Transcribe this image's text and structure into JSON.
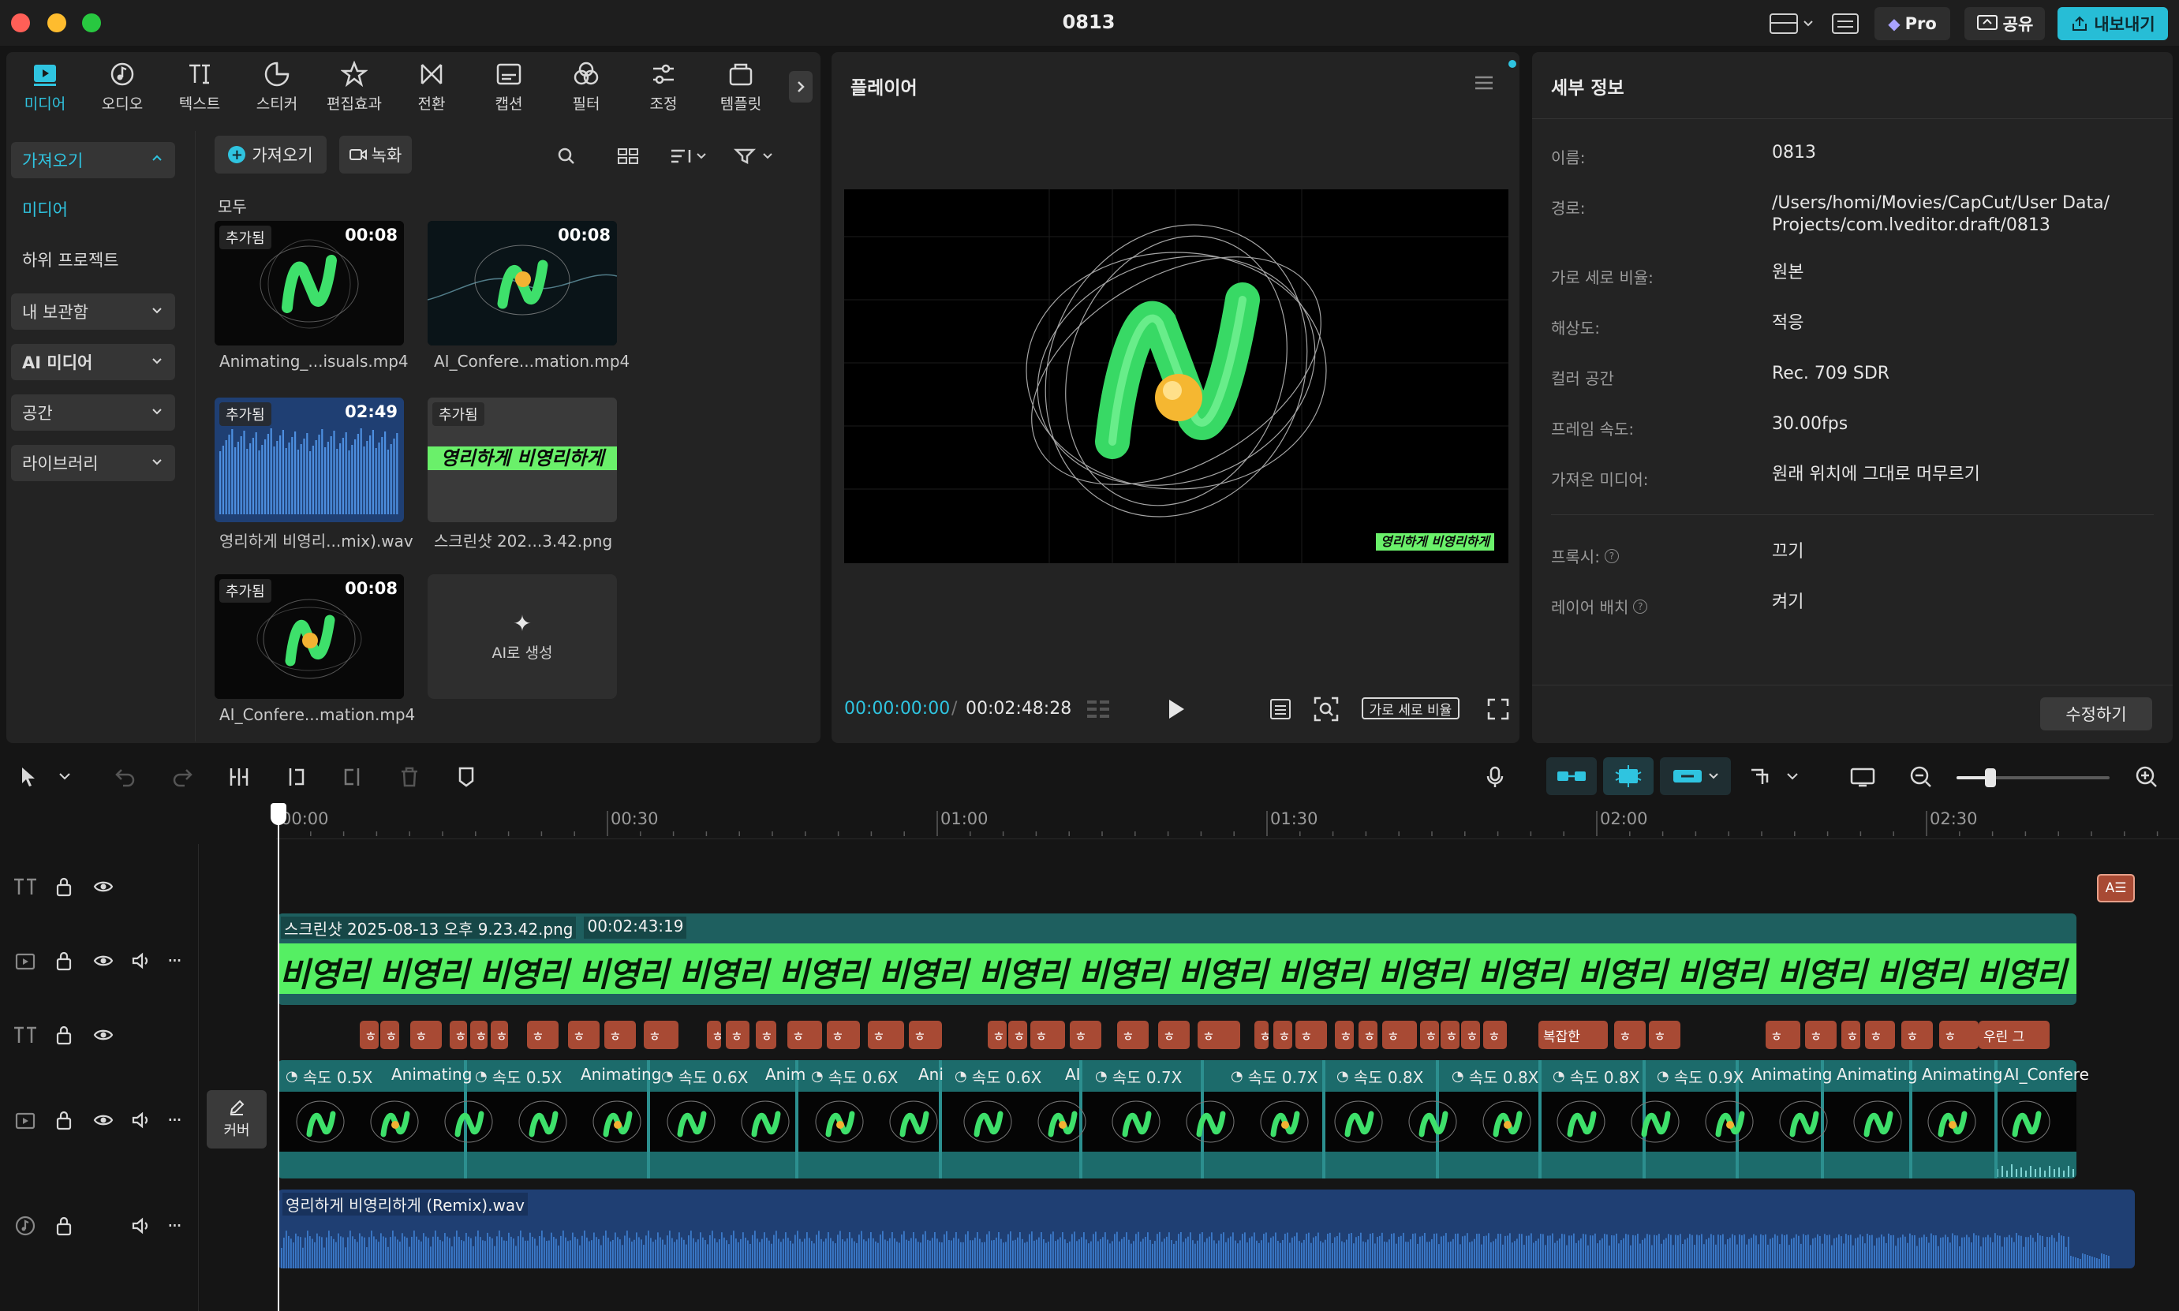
{
  "window": {
    "title": "0813"
  },
  "topbar": {
    "pro_label": "Pro",
    "share_label": "공유",
    "export_label": "내보내기"
  },
  "tool_tabs": [
    {
      "label": "미디어",
      "icon": "media-icon"
    },
    {
      "label": "오디오",
      "icon": "audio-icon"
    },
    {
      "label": "텍스트",
      "icon": "text-icon"
    },
    {
      "label": "스티커",
      "icon": "sticker-icon"
    },
    {
      "label": "편집효과",
      "icon": "effects-icon"
    },
    {
      "label": "전환",
      "icon": "transition-icon"
    },
    {
      "label": "캡션",
      "icon": "caption-icon"
    },
    {
      "label": "필터",
      "icon": "filter-icon"
    },
    {
      "label": "조정",
      "icon": "adjust-icon"
    },
    {
      "label": "템플릿",
      "icon": "template-icon"
    }
  ],
  "side_nav": {
    "import": "가져오기",
    "media": "미디어",
    "subproject": "하위 프로젝트",
    "my_storage": "내 보관함",
    "ai_media": "AI 미디어",
    "space": "공간",
    "library": "라이브러리"
  },
  "media_toolbar": {
    "import_button": "가져오기",
    "record_button": "녹화",
    "all_label": "모두"
  },
  "media_items": [
    {
      "name": "Animating_...isuals.mp4",
      "badge": "추가됨",
      "duration": "00:08"
    },
    {
      "name": "AI_Confere...mation.mp4",
      "badge": "",
      "duration": "00:08"
    },
    {
      "name": "영리하게 비영리...mix).wav",
      "badge": "추가됨",
      "duration": "02:49"
    },
    {
      "name": "스크린샷 202...3.42.png",
      "badge": "추가됨",
      "duration": "",
      "preview_text": "영리하게 비영리하게"
    },
    {
      "name": "AI_Confere...mation.mp4",
      "badge": "추가됨",
      "duration": "00:08"
    }
  ],
  "ai_generate_label": "AI로 생성",
  "player": {
    "title": "플레이어",
    "current_time": "00:00:00:00",
    "total_time": "00:02:48:28",
    "aspect_button": "가로 세로 비율",
    "overlay_text": "영리하게 비영리하게"
  },
  "details": {
    "title": "세부 정보",
    "rows": [
      {
        "label": "이름:",
        "value": "0813"
      },
      {
        "label": "경로:",
        "value": "/Users/homi/Movies/CapCut/User Data/",
        "value2": "Projects/com.lveditor.draft/0813"
      },
      {
        "label": "가로 세로 비율:",
        "value": "원본"
      },
      {
        "label": "해상도:",
        "value": "적응"
      },
      {
        "label": "컬러 공간",
        "value": "Rec. 709 SDR"
      },
      {
        "label": "프레임 속도:",
        "value": "30.00fps"
      },
      {
        "label": "가져온 미디어:",
        "value": "원래 위치에 그대로 머무르기"
      },
      {
        "label": "프록시:",
        "value": "끄기"
      },
      {
        "label": "레이어 배치",
        "value": "켜기"
      }
    ],
    "edit_button": "수정하기"
  },
  "timeline": {
    "ruler": [
      "00:00",
      "00:30",
      "01:00",
      "01:30",
      "02:00",
      "02:30"
    ],
    "cover_label": "커버",
    "image_clip": {
      "name": "스크린샷 2025-08-13 오후 9.23.42.png",
      "duration": "00:02:43:19",
      "repeat_text": "비영리 비영리 비영리 비영리 비영리 비영리 비영리 비영리 비영리 비영리 비영리 비영리 비영리 비영리 비영리 비영리 비영리 비영리 비영리 비영리 비영리 비영리 비영리 비영"
    },
    "audio_clip": {
      "name": "영리하게 비영리하게 (Remix).wav"
    },
    "text_chips": [
      "복잡한",
      "우린 그"
    ],
    "speed_tags": [
      "속도 0.5X",
      "속도 0.5X",
      "속도 0.6X",
      "속도 0.6X",
      "속도 0.6X",
      "속도 0.7X",
      "속도 0.7X",
      "속도 0.8X",
      "속도 0.8X",
      "속도 0.8X",
      "속도 0.9X"
    ],
    "clip_names": [
      "Animating",
      "Animating",
      "Anim",
      "Ani",
      "AI",
      "Animating",
      "Animating",
      "Animating",
      "AI_Confere"
    ]
  },
  "colors": {
    "accent": "#2fc4e0",
    "text_clip": "#a84a34",
    "image_clip": "#3ae86b",
    "video_track": "#1c6b6b",
    "audio_track": "#1f3f73"
  }
}
